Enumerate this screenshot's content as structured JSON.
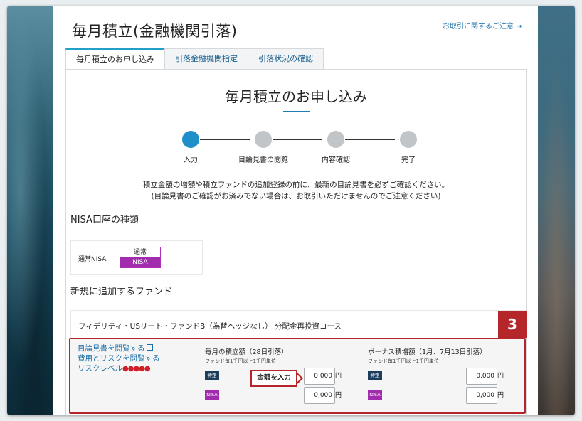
{
  "page": {
    "title": "毎月積立(金融機関引落)",
    "notice_link": "お取引に関するご注意 →"
  },
  "tabs": [
    {
      "label": "毎月積立のお申し込み",
      "active": true
    },
    {
      "label": "引落金融機関指定",
      "active": false
    },
    {
      "label": "引落状況の確認",
      "active": false
    }
  ],
  "main": {
    "heading": "毎月積立のお申し込み",
    "steps": [
      {
        "label": "入力",
        "done": true
      },
      {
        "label": "目論見書の閲覧",
        "done": false
      },
      {
        "label": "内容確認",
        "done": false
      },
      {
        "label": "完了",
        "done": false
      }
    ],
    "intro_line1": "積立金額の増額や積立ファンドの追加登録の前に、最新の目論見書を必ずご確認ください。",
    "intro_line2": "(目論見書のご確認がお済みでない場合は、お取引いただけませんのでご注意ください)"
  },
  "nisa": {
    "section_title": "NISA口座の種類",
    "account_label": "通常NISA",
    "toggle_off": "通常",
    "toggle_on": "NISA"
  },
  "fund": {
    "section_title": "新規に追加するファンド",
    "name": "フィデリティ・USリート・ファンドB（為替ヘッジなし） 分配金再投資コース",
    "badge": "3",
    "link_prospectus": "目論見書を閲覧する",
    "link_costs": "費用とリスクを閲覧する",
    "risk_label": "リスクレベル",
    "risk_dots": "●●●●●",
    "monthly": {
      "title": "毎月の積立額（28日引落）",
      "subtitle": "ファンド毎1千円以上1千円単位",
      "tag_tokutei": "特定",
      "tag_nisa": "NISA",
      "value_tokutei": "0,000",
      "value_nisa": "0,000",
      "unit": "円"
    },
    "bonus": {
      "title": "ボーナス積増額（1月、7月13日引落）",
      "subtitle": "ファンド毎1千円以上1千円単位",
      "tag_tokutei": "特定",
      "tag_nisa": "NISA",
      "value_tokutei": "0,000",
      "value_nisa": "0,000",
      "unit": "円"
    },
    "callout": "金額を入力"
  },
  "colors": {
    "accent_blue": "#1f8fc9",
    "link_blue": "#1b6ea8",
    "highlight_red": "#b5262b",
    "nisa_purple": "#a22cae",
    "tokutei_navy": "#1b3e5c"
  }
}
